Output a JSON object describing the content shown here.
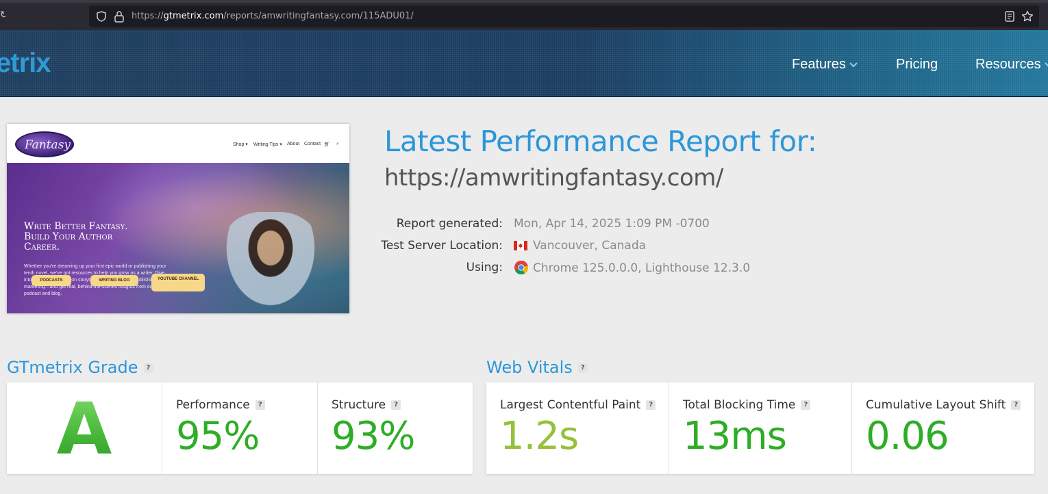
{
  "browser": {
    "url_prefix": "https://",
    "url_domain": "gtmetrix.com",
    "url_path": "/reports/amwritingfantasy.com/115ADU01/",
    "icons": [
      "shield-icon",
      "lock-icon",
      "reader-view-icon",
      "bookmark-star-icon",
      "reload-icon"
    ]
  },
  "site": {
    "logo_text": "etrix",
    "nav": [
      {
        "label": "Features",
        "has_dropdown": true
      },
      {
        "label": "Pricing",
        "has_dropdown": false
      },
      {
        "label": "Resources",
        "has_dropdown": true
      }
    ]
  },
  "thumbnail": {
    "logo_text": "Fantasy",
    "menu": [
      "Shop ▾",
      "Writing Tips ▾",
      "About",
      "Contact"
    ],
    "headline_lines": [
      "Write Better Fantasy.",
      "Build Your Author",
      "Career."
    ],
    "paragraph": "Whether you're dreaming up your first epic world or publishing your tenth novel, we've got resources to help you grow as a writer. Dive into author-tested tips on storytelling, worldbuilding, publishing, and marketing—and get real, behind-the-scenes insights from our podcast and blog.",
    "buttons": [
      "PODCASTS",
      "WRITING BLOG",
      "YOUTUBE CHANNEL"
    ]
  },
  "report": {
    "title": "Latest Performance Report for:",
    "url": "https://amwritingfantasy.com/",
    "meta": [
      {
        "label": "Report generated:",
        "value": "Mon, Apr 14, 2025 1:09 PM -0700"
      },
      {
        "label": "Test Server Location:",
        "value": "Vancouver, Canada"
      },
      {
        "label": "Using:",
        "value": "Chrome 125.0.0.0, Lighthouse 12.3.0"
      }
    ]
  },
  "grade": {
    "title": "GTmetrix Grade",
    "help": "?",
    "letter": "A",
    "performance_label": "Performance",
    "performance_value": "95%",
    "structure_label": "Structure",
    "structure_value": "93%",
    "colors": {
      "performance": "#2ead26",
      "structure": "#2ead26"
    }
  },
  "vitals": {
    "title": "Web Vitals",
    "help": "?",
    "lcp_label": "Largest Contentful Paint",
    "lcp_value": "1.2s",
    "tbt_label": "Total Blocking Time",
    "tbt_value": "13ms",
    "cls_label": "Cumulative Layout Shift",
    "cls_value": "0.06",
    "colors": {
      "lcp": "#95c13a",
      "tbt": "#2ead26",
      "cls": "#2ead26"
    }
  }
}
